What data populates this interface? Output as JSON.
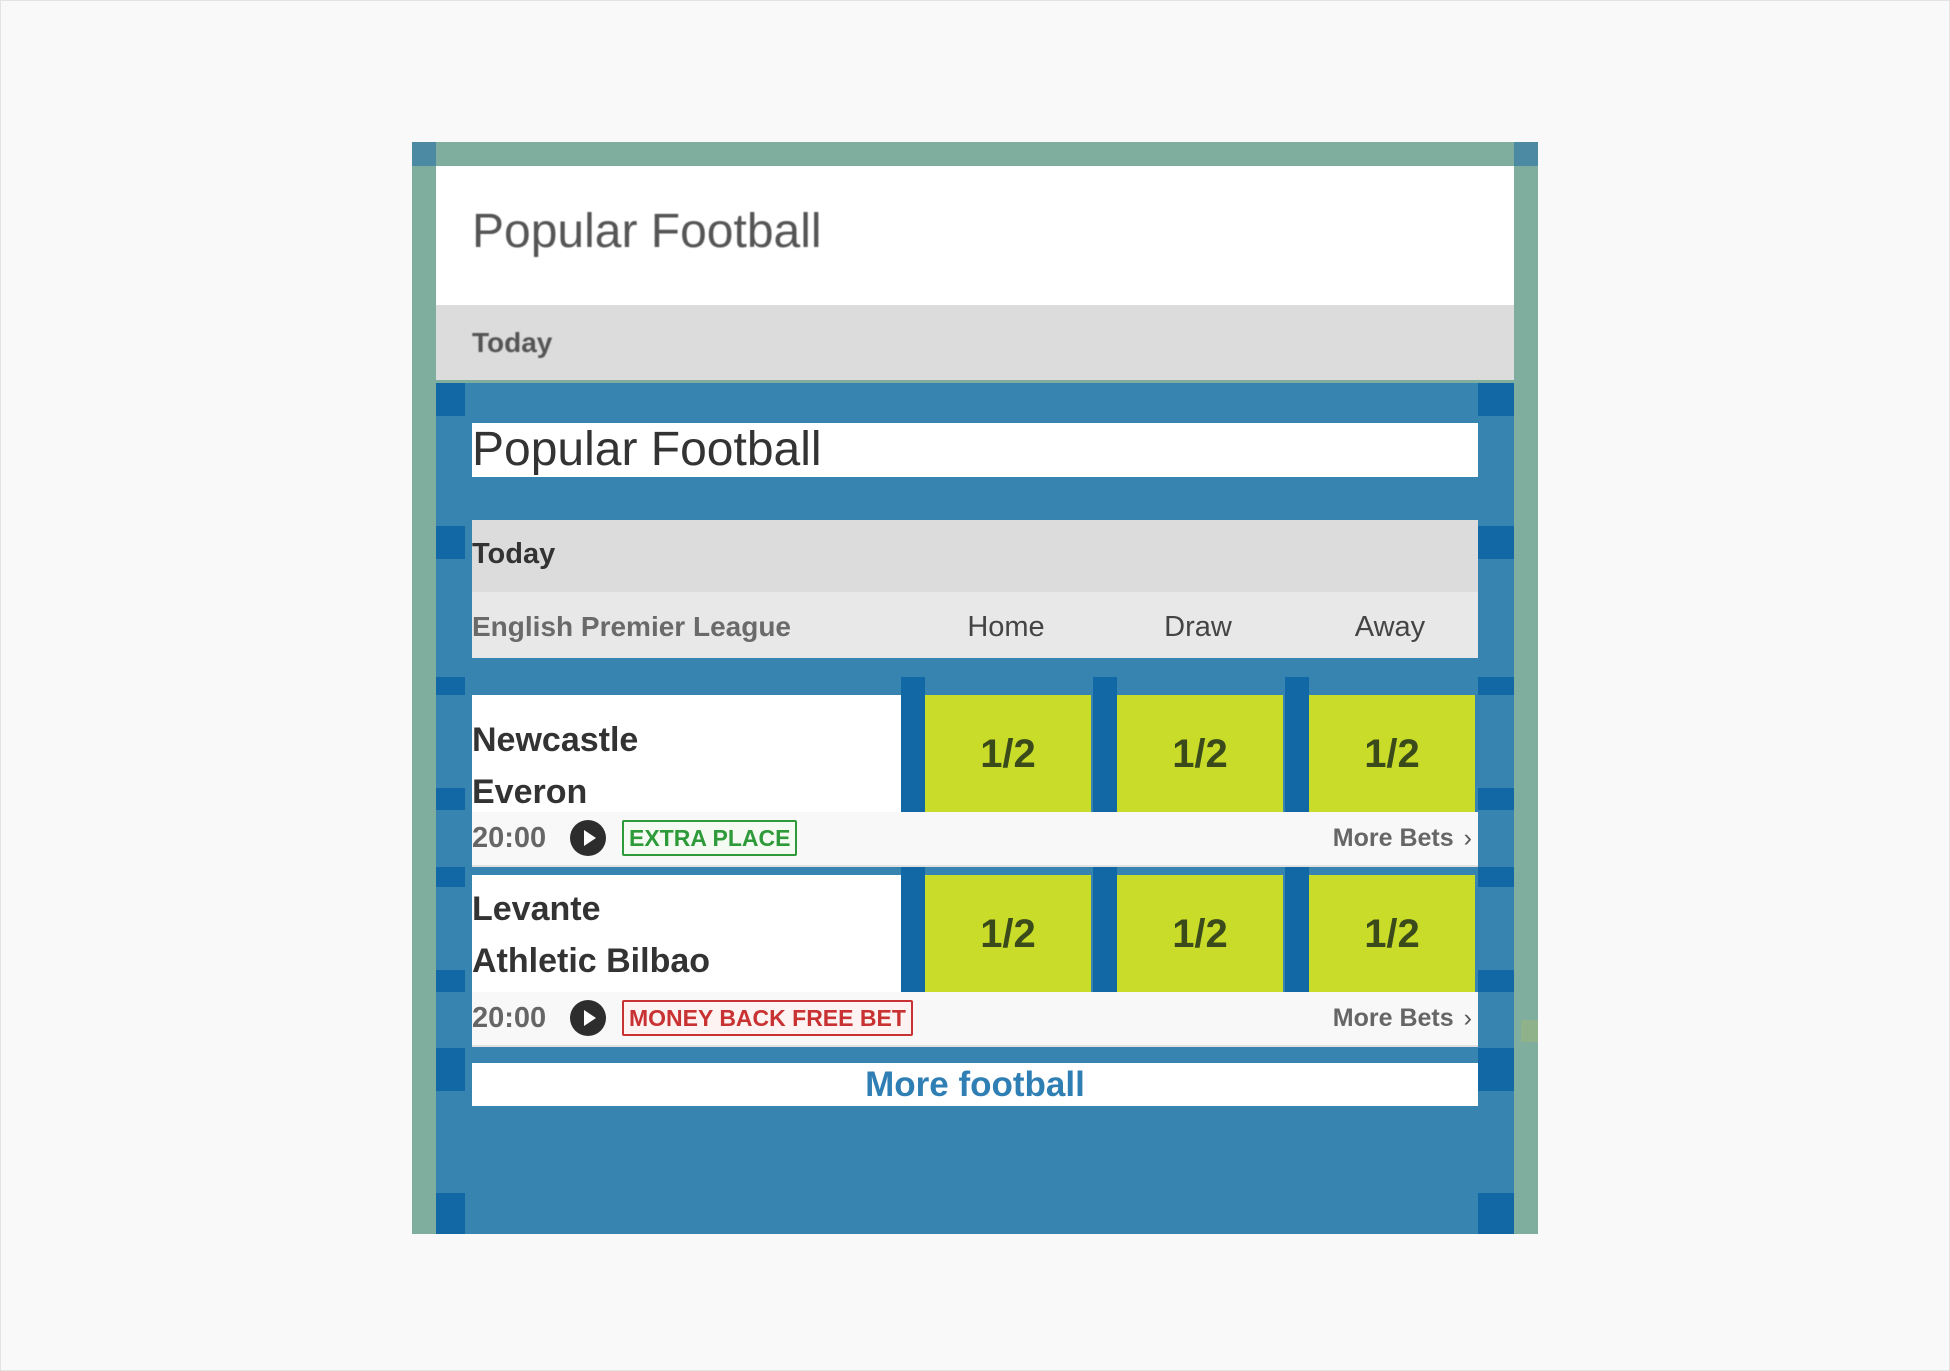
{
  "header": {
    "title": "Popular Football",
    "section": "Today"
  },
  "panel": {
    "title": "Popular Football",
    "section": "Today",
    "league": "English Premier League",
    "columns": {
      "home": "Home",
      "draw": "Draw",
      "away": "Away"
    }
  },
  "matches": [
    {
      "home_team": "Newcastle",
      "away_team": "Everon",
      "odds": {
        "home": "1/2",
        "draw": "1/2",
        "away": "1/2"
      },
      "time": "20:00",
      "badge": "EXTRA PLACE",
      "more_bets": "More Bets"
    },
    {
      "home_team": "Levante",
      "away_team": "Athletic Bilbao",
      "odds": {
        "home": "1/2",
        "draw": "1/2",
        "away": "1/2"
      },
      "time": "20:00",
      "badge": "MONEY BACK FREE BET",
      "more_bets": "More Bets"
    }
  ],
  "footer": {
    "more_link": "More football"
  },
  "icons": {
    "play": "play-circle-icon",
    "chevron": "chevron-right-icon"
  },
  "colors": {
    "odds_button": "#c9dc2a",
    "link_blue": "#2f7fb4",
    "badge_green": "#2e9a3a",
    "badge_red": "#c83232"
  }
}
